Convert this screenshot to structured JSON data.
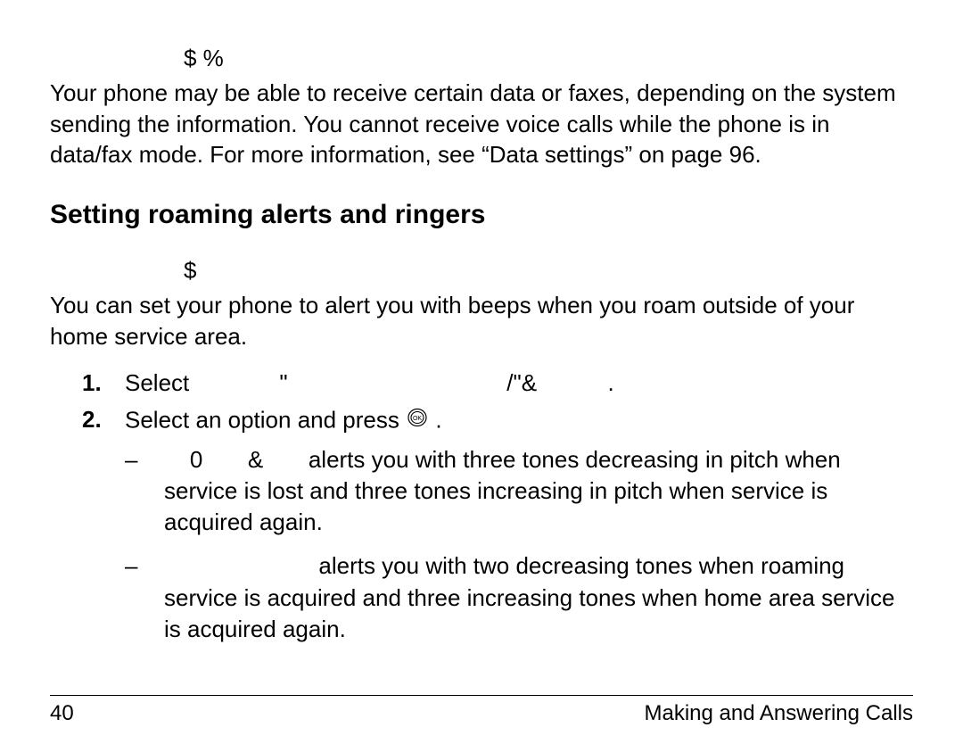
{
  "top_marker": "$ %",
  "datafax_paragraph": "Your phone may be able to receive certain data or faxes, depending on the system sending the information. You cannot receive voice calls while the phone is in data/fax mode. For more information, see “Data settings” on page 96.",
  "section_heading": "Setting roaming alerts and ringers",
  "sub_marker": "$",
  "roam_intro": "You can set your phone to alert you with beeps when you roam outside of your home service area.",
  "steps": {
    "num1": "1.",
    "step1_leading": "Select ",
    "step1_gap1": "             ",
    "step1_q": "\"",
    "step1_gap2": "                                  ",
    "step1_sym": "/\"&",
    "step1_gap3": "           ",
    "step1_dot": ".",
    "num2": "2.",
    "step2_text": "Select an option and press ",
    "step2_dot": " ."
  },
  "bullets": {
    "dash": "–",
    "b1_lead": "    0       &       ",
    "b1_rest": "alerts you with three tones decreasing in pitch when service is lost and three tones increasing in pitch when service is acquired again.",
    "b2_lead": "                        ",
    "b2_rest": "alerts you with two decreasing tones when roaming service is acquired and three increasing tones when home area service is acquired again."
  },
  "footer": {
    "page_number": "40",
    "section_title": "Making and Answering Calls"
  }
}
